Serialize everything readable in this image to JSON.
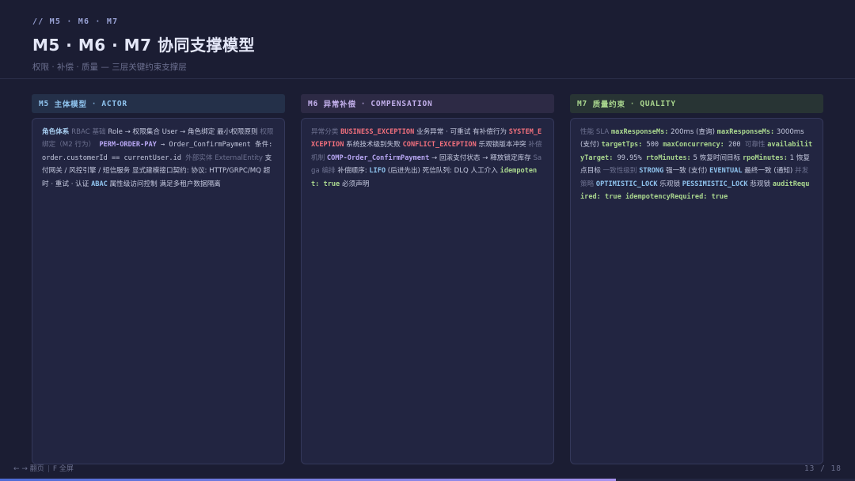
{
  "header": {
    "breadcrumb": "// M5 · M6 · M7",
    "title": "M5 · M6 · M7 协同支撑模型",
    "subtitle": "权限 · 补偿 · 质量 — 三层关键约束支撑层"
  },
  "columns": [
    {
      "code": "M5",
      "name": "主体模型",
      "tag": "ACTOR",
      "segments": [
        {
          "t": "角色体系",
          "c": "lead"
        },
        {
          "t": " RBAC 基础 ",
          "c": "k"
        },
        {
          "t": "Role → 权限集合 User → 角色绑定 最小权限原则 ",
          "c": "cn"
        },
        {
          "t": "权限绑定（M2 行为）",
          "c": "k"
        },
        {
          "t": " PERM-ORDER-PAY",
          "c": "purp"
        },
        {
          "t": " → Order_ConfirmPayment 条件: order.customerId == currentUser.id ",
          "c": "plain"
        },
        {
          "t": "外部实体 ExternalEntity",
          "c": "k"
        },
        {
          "t": " 支付网关 / 风控引擎 / 短信服务 显式建模接口契约: 协议: HTTP/GRPC/MQ 超时 · 重试 · 认证 ",
          "c": "cn"
        },
        {
          "t": "ABAC",
          "c": "blue"
        },
        {
          "t": " 属性级访问控制 满足多租户数据隔离",
          "c": "cn"
        }
      ]
    },
    {
      "code": "M6",
      "name": "异常补偿",
      "tag": "COMPENSATION",
      "segments": [
        {
          "t": "异常分类 ",
          "c": "k"
        },
        {
          "t": "BUSINESS_EXCEPTION",
          "c": "red"
        },
        {
          "t": " 业务异常 · 可重试 有补偿行为 ",
          "c": "cn"
        },
        {
          "t": "SYSTEM_EXCEPTION",
          "c": "red"
        },
        {
          "t": " 系统技术级别失败 ",
          "c": "cn"
        },
        {
          "t": "CONFLICT_EXCEPTION",
          "c": "red"
        },
        {
          "t": " 乐观锁版本冲突 ",
          "c": "cn"
        },
        {
          "t": "补偿机制 ",
          "c": "k"
        },
        {
          "t": "COMP-Order_ConfirmPayment",
          "c": "purp"
        },
        {
          "t": " → 回滚支付状态 → 释放锁定库存 ",
          "c": "cn"
        },
        {
          "t": "Saga 编排",
          "c": "k"
        },
        {
          "t": " 补偿顺序: ",
          "c": "cn"
        },
        {
          "t": "LIFO",
          "c": "blue"
        },
        {
          "t": " (后进先出) 死信队列: DLQ 人工介入 ",
          "c": "cn"
        },
        {
          "t": "idempotent: true",
          "c": "grn"
        },
        {
          "t": " 必须声明",
          "c": "cn"
        }
      ]
    },
    {
      "code": "M7",
      "name": "质量约束",
      "tag": "QUALITY",
      "segments": [
        {
          "t": "性能 SLA ",
          "c": "k"
        },
        {
          "t": "maxResponseMs:",
          "c": "grn"
        },
        {
          "t": " 200ms (查询) ",
          "c": "cn"
        },
        {
          "t": "maxResponseMs:",
          "c": "grn"
        },
        {
          "t": " 3000ms (支付) ",
          "c": "cn"
        },
        {
          "t": "targetTps:",
          "c": "grn"
        },
        {
          "t": " 500 ",
          "c": "plain"
        },
        {
          "t": "maxConcurrency:",
          "c": "grn"
        },
        {
          "t": " 200 ",
          "c": "plain"
        },
        {
          "t": "可靠性 ",
          "c": "k"
        },
        {
          "t": "availabilityTarget:",
          "c": "grn"
        },
        {
          "t": " 99.95% ",
          "c": "plain"
        },
        {
          "t": "rtoMinutes:",
          "c": "grn"
        },
        {
          "t": " 5 恢复时间目标 ",
          "c": "cn"
        },
        {
          "t": "rpoMinutes:",
          "c": "grn"
        },
        {
          "t": " 1 恢复点目标 ",
          "c": "cn"
        },
        {
          "t": "一致性级别 ",
          "c": "k"
        },
        {
          "t": "STRONG",
          "c": "blue"
        },
        {
          "t": " 强一致 (支付) ",
          "c": "cn"
        },
        {
          "t": "EVENTUAL",
          "c": "blue"
        },
        {
          "t": " 最终一致 (通知) ",
          "c": "cn"
        },
        {
          "t": "并发策略 ",
          "c": "k"
        },
        {
          "t": "OPTIMISTIC_LOCK",
          "c": "blue"
        },
        {
          "t": " 乐观锁 ",
          "c": "cn"
        },
        {
          "t": "PESSIMISTIC_LOCK",
          "c": "blue"
        },
        {
          "t": " 悲观锁 ",
          "c": "cn"
        },
        {
          "t": "auditRequired: true",
          "c": "grn"
        },
        {
          "t": " ",
          "c": "plain"
        },
        {
          "t": "idempotencyRequired: true",
          "c": "grn"
        }
      ]
    }
  ],
  "footer": {
    "nav": "← → 翻页",
    "fullscreen": "F 全屏",
    "page": "13 / 18",
    "progress": 0.72
  }
}
